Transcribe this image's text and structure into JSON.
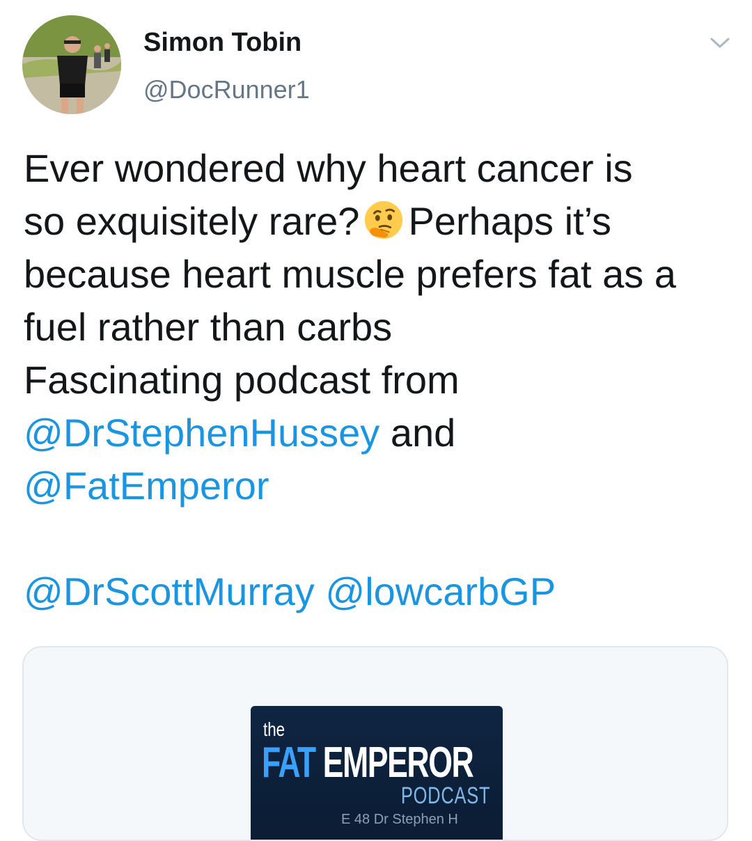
{
  "author": {
    "display_name": "Simon Tobin",
    "handle": "@DocRunner1"
  },
  "tweet": {
    "line1": "Ever wondered why heart cancer is",
    "line2_a": "so exquisitely rare?",
    "line2_b": "Perhaps it’s",
    "line3": "because heart muscle prefers fat as a",
    "line4": "fuel rather than carbs",
    "line5": "Fascinating podcast from",
    "mention1": "@DrStephenHussey",
    "and": "and",
    "mention2": "@FatEmperor",
    "mention3": "@DrScottMurray",
    "mention4": "@lowcarbGP",
    "emoji": "thinking-face-emoji"
  },
  "card": {
    "art_the": "the",
    "art_fat": "FAT",
    "art_emperor": "EMPEROR",
    "art_podcast": "PODCAST",
    "art_footer": "E 48 Dr Stephen H"
  },
  "colors": {
    "text": "#14171a",
    "secondary": "#657786",
    "mention": "#1b95e0",
    "card_border": "#e1e8ed",
    "podcast_bg": "#0f2542",
    "podcast_accent": "#3aa0ff"
  },
  "icons": [
    "chevron-down-icon"
  ]
}
